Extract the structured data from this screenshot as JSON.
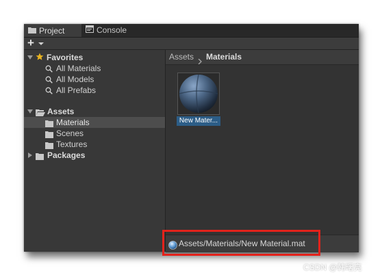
{
  "tabs": [
    {
      "label": "Project",
      "icon": "folder-icon",
      "active": true
    },
    {
      "label": "Console",
      "icon": "console-icon",
      "active": false
    }
  ],
  "toolbar": {
    "add_label": "+"
  },
  "tree": {
    "favorites": {
      "label": "Favorites",
      "items": [
        "All Materials",
        "All Models",
        "All Prefabs"
      ]
    },
    "assets": {
      "label": "Assets",
      "items": [
        "Materials",
        "Scenes",
        "Textures"
      ],
      "selected": "Materials"
    },
    "packages": {
      "label": "Packages"
    }
  },
  "breadcrumb": {
    "root": "Assets",
    "current": "Materials"
  },
  "grid": {
    "items": [
      {
        "label": "New Mater...",
        "type": "material"
      }
    ]
  },
  "status": {
    "path": "Assets/Materials/New Material.mat"
  },
  "watermark": "CSDN @韩曙亮",
  "colors": {
    "window_bg": "#383838",
    "selection": "#2c5d87",
    "highlight_box": "#e3221b",
    "star": "#e8b321"
  }
}
